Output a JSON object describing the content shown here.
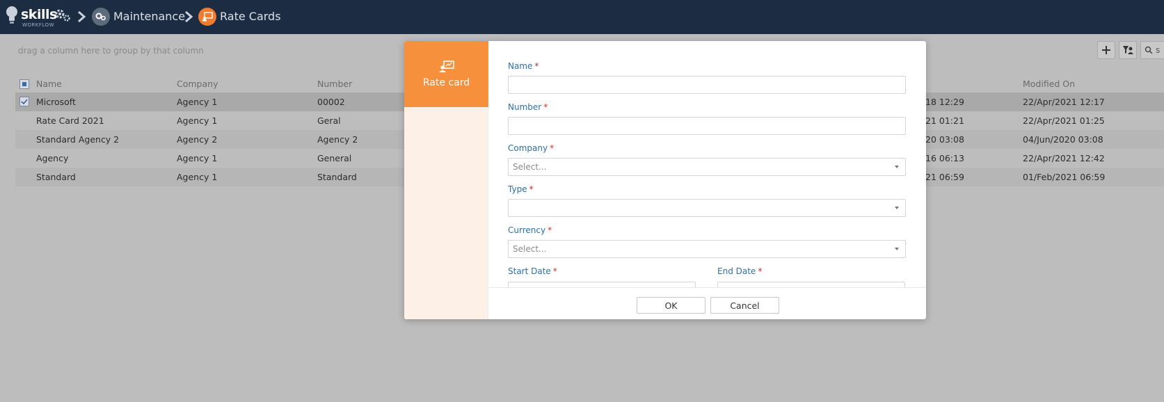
{
  "app": {
    "logo_text": "skills",
    "logo_sub": "WORKFLOW"
  },
  "breadcrumb": [
    {
      "label": "Maintenance",
      "icon": "gears-icon"
    },
    {
      "label": "Rate Cards",
      "icon": "rate-card-icon"
    }
  ],
  "grid": {
    "group_hint": "drag a column here to group by that column",
    "columns": {
      "name": "Name",
      "company": "Company",
      "number": "Number",
      "modified_on": "Modified On"
    },
    "rows": [
      {
        "name": "Microsoft",
        "company": "Agency 1",
        "number": "00002",
        "created_tail": "18 12:29",
        "modified": "22/Apr/2021 12:17",
        "selected": true
      },
      {
        "name": "Rate Card 2021",
        "company": "Agency 1",
        "number": "Geral",
        "created_tail": "21 01:21",
        "modified": "22/Apr/2021 01:25"
      },
      {
        "name": "Standard Agency 2",
        "company": "Agency 2",
        "number": "Agency 2",
        "created_tail": "20 03:08",
        "modified": "04/Jun/2020 03:08"
      },
      {
        "name": "Agency",
        "company": "Agency 1",
        "number": "General",
        "created_tail": "16 06:13",
        "modified": "22/Apr/2021 12:42"
      },
      {
        "name": "Standard",
        "company": "Agency 1",
        "number": "Standard",
        "created_tail": "21 06:59",
        "modified": "01/Feb/2021 06:59"
      }
    ],
    "search_partial": "s"
  },
  "modal": {
    "tab_label": "Rate card",
    "fields": {
      "name": {
        "label": "Name",
        "value": ""
      },
      "number": {
        "label": "Number",
        "value": ""
      },
      "company": {
        "label": "Company",
        "placeholder": "Select..."
      },
      "type": {
        "label": "Type",
        "placeholder": ""
      },
      "currency": {
        "label": "Currency",
        "placeholder": "Select..."
      },
      "start_date": {
        "label": "Start Date"
      },
      "end_date": {
        "label": "End Date"
      }
    },
    "required_mark": "*",
    "ok_label": "OK",
    "cancel_label": "Cancel"
  },
  "colors": {
    "topbar": "#1c2d43",
    "accent_orange": "#f7903d",
    "label_blue": "#2f6fa8",
    "required_red": "#d12b2b"
  }
}
